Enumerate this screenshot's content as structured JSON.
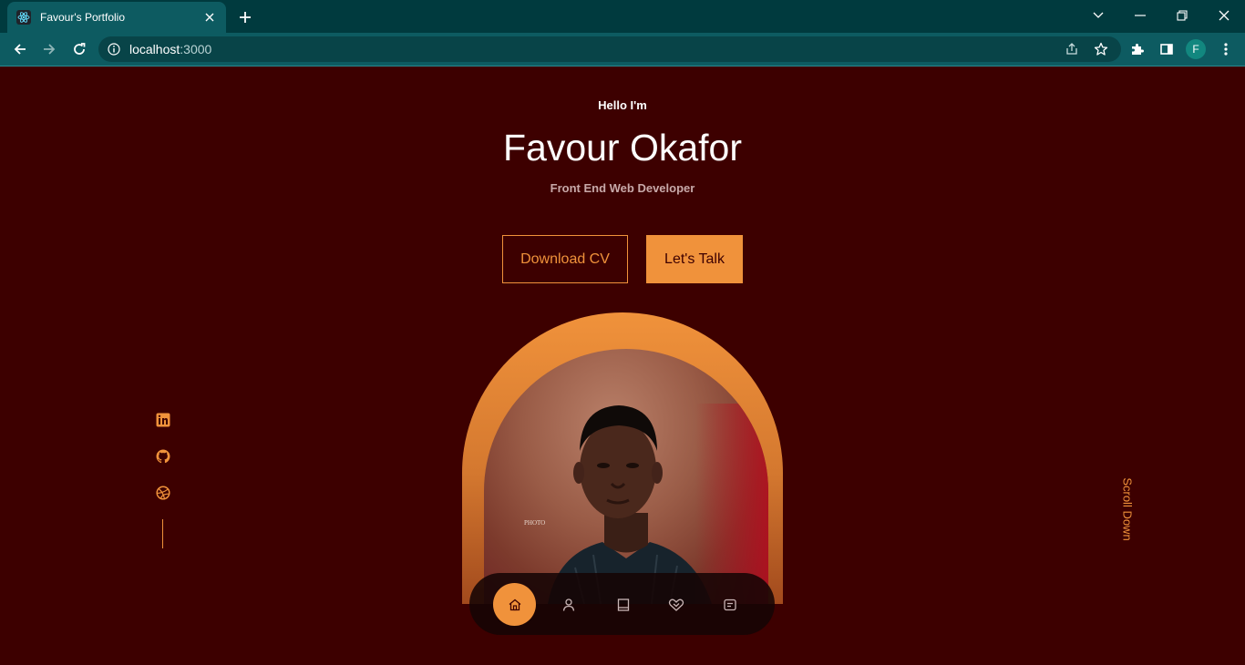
{
  "browser": {
    "tab_title": "Favour's Portfolio",
    "url_host": "localhost",
    "url_port": ":3000",
    "profile_initial": "F",
    "colors": {
      "tabbar": "#003a3e",
      "toolbar": "#0d5b61"
    }
  },
  "hero": {
    "greeting": "Hello I'm",
    "name": "Favour Okafor",
    "role": "Front End Web Developer",
    "download_cv": "Download CV",
    "lets_talk": "Let's Talk"
  },
  "social": [
    "linkedin-icon",
    "github-icon",
    "dribbble-icon"
  ],
  "scroll_label": "Scroll Down",
  "photo_watermark": "PHOTO",
  "nav": {
    "items": [
      "home-icon",
      "user-icon",
      "book-icon",
      "handshake-icon",
      "message-icon"
    ],
    "active": "home"
  },
  "colors": {
    "background": "#3d0000",
    "accent": "#f0923b",
    "text": "#ffffff",
    "muted": "#c8a9a9"
  }
}
